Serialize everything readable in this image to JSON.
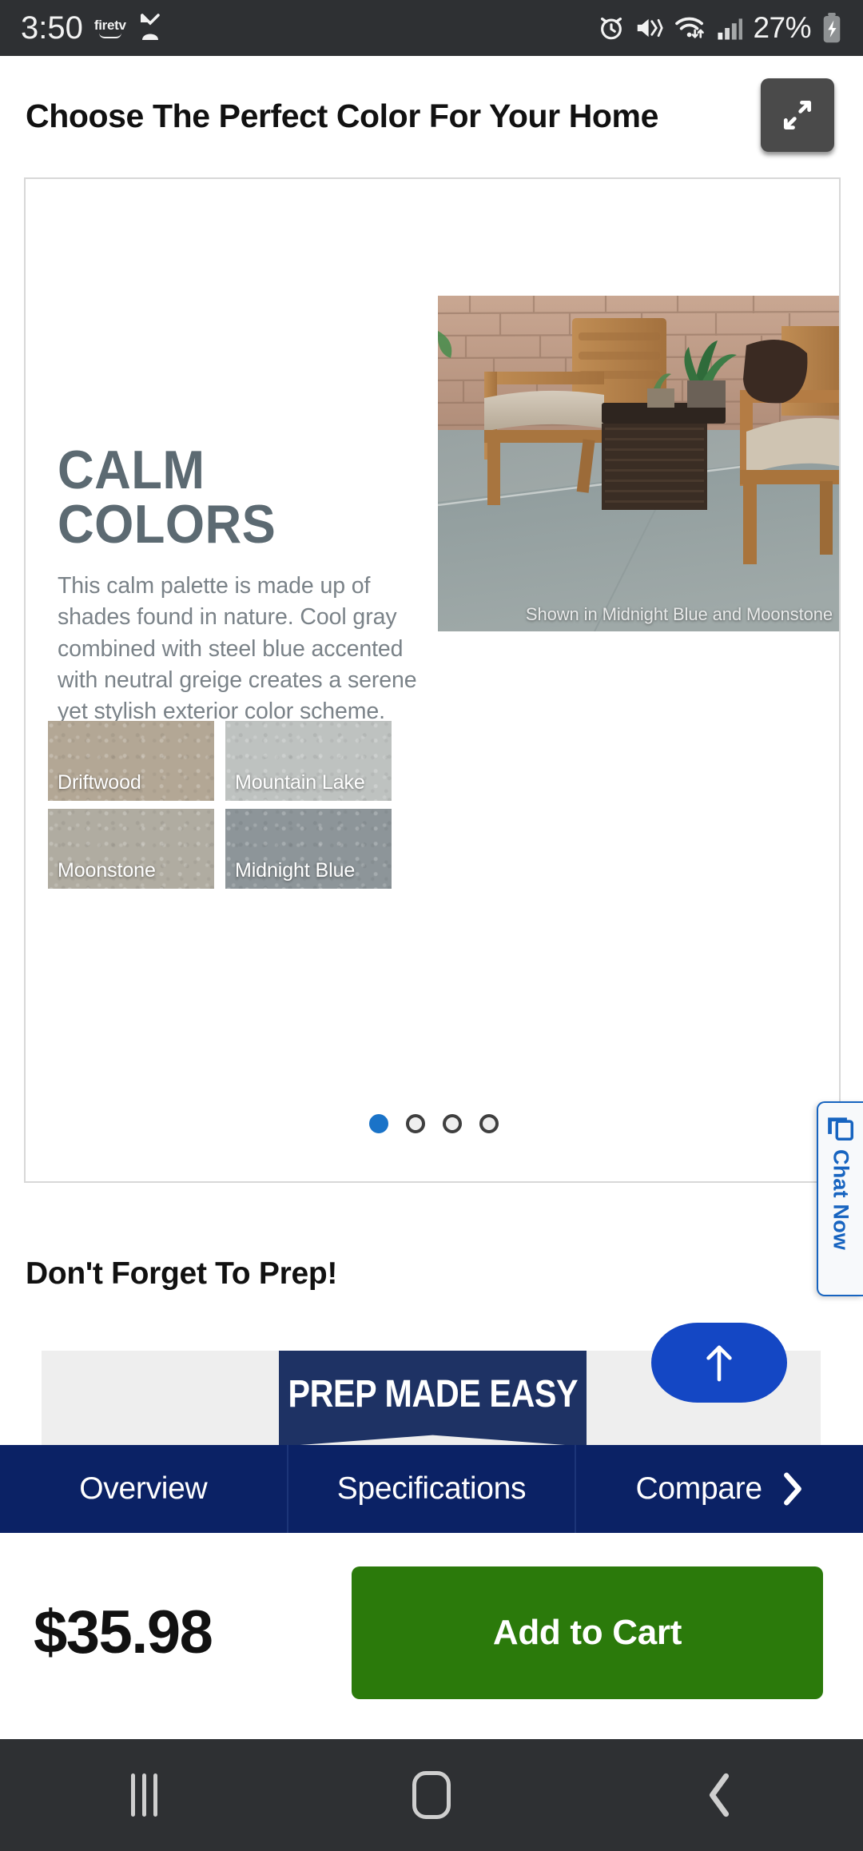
{
  "status_bar": {
    "time": "3:50",
    "app_badge": "firetv",
    "battery_percent": "27%",
    "icons": [
      "alarm-icon",
      "vibrate-mute-icon",
      "wifi-icon",
      "cellular-signal-icon",
      "battery-charging-icon"
    ]
  },
  "header": {
    "title": "Choose The Perfect Color For Your Home",
    "expand_icon": "expand-arrows-icon"
  },
  "carousel": {
    "slide": {
      "heading": "CALM COLORS",
      "body": "This calm palette is made up of shades found in nature. Cool gray combined with steel blue accented with neutral greige creates a serene yet stylish exterior color scheme.",
      "photo_caption": "Shown in Midnight Blue and Moonstone",
      "swatches": [
        {
          "name": "Driftwood",
          "hex": "#b3a795"
        },
        {
          "name": "Mountain Lake",
          "hex": "#bec2c0"
        },
        {
          "name": "Moonstone",
          "hex": "#b0aca1"
        },
        {
          "name": "Midnight Blue",
          "hex": "#8d9599"
        }
      ]
    },
    "dots": {
      "count": 4,
      "active_index": 0,
      "active_color": "#1a73c8"
    }
  },
  "chat_widget": {
    "label": "Chat Now",
    "icon": "chat-bubble-icon",
    "color": "#1764c0"
  },
  "prep_section": {
    "heading": "Don't Forget To Prep!",
    "banner_text": "PREP MADE EASY",
    "banner_color": "#1e3264"
  },
  "scroll_top_button": {
    "icon": "arrow-up-icon",
    "color": "#1447c4"
  },
  "tab_bar": {
    "background": "#0b2265",
    "tabs": [
      {
        "label": "Overview"
      },
      {
        "label": "Specifications"
      },
      {
        "label": "Compare",
        "icon": "chevron-right-icon"
      }
    ]
  },
  "buy_bar": {
    "price": "$35.98",
    "add_to_cart_label": "Add to Cart",
    "cart_color": "#2b7a0b"
  },
  "nav_bar": {
    "buttons": [
      "recents-icon",
      "home-icon",
      "back-icon"
    ]
  }
}
